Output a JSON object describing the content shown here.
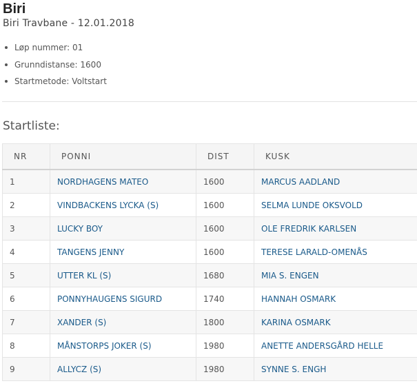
{
  "header": {
    "track": "Biri",
    "subtitle": "Biri Travbane - 12.01.2018"
  },
  "race_info": [
    "Løp nummer: 01",
    "Grunndistanse: 1600",
    "Startmetode: Voltstart"
  ],
  "startlist": {
    "heading": "Startliste:",
    "columns": [
      "NR",
      "PONNI",
      "DIST",
      "KUSK"
    ],
    "rows": [
      {
        "nr": "1",
        "ponni": "NORDHAGENS MATEO",
        "dist": "1600",
        "kusk": "MARCUS AADLAND"
      },
      {
        "nr": "2",
        "ponni": "VINDBACKENS LYCKA (S)",
        "dist": "1600",
        "kusk": "SELMA LUNDE OKSVOLD"
      },
      {
        "nr": "3",
        "ponni": "LUCKY BOY",
        "dist": "1600",
        "kusk": "OLE FREDRIK KARLSEN"
      },
      {
        "nr": "4",
        "ponni": "TANGENS JENNY",
        "dist": "1600",
        "kusk": "TERESE LARALD-OMENÅS"
      },
      {
        "nr": "5",
        "ponni": "UTTER KL (S)",
        "dist": "1680",
        "kusk": "MIA S. ENGEN"
      },
      {
        "nr": "6",
        "ponni": "PONNYHAUGENS SIGURD",
        "dist": "1740",
        "kusk": "HANNAH OSMARK"
      },
      {
        "nr": "7",
        "ponni": "XANDER (S)",
        "dist": "1800",
        "kusk": "KARINA OSMARK"
      },
      {
        "nr": "8",
        "ponni": "MÅNSTORPS JOKER (S)",
        "dist": "1980",
        "kusk": "ANETTE ANDERSGÅRD HELLE"
      },
      {
        "nr": "9",
        "ponni": "ALLYCZ (S)",
        "dist": "1980",
        "kusk": "SYNNE S. ENGH"
      }
    ]
  }
}
